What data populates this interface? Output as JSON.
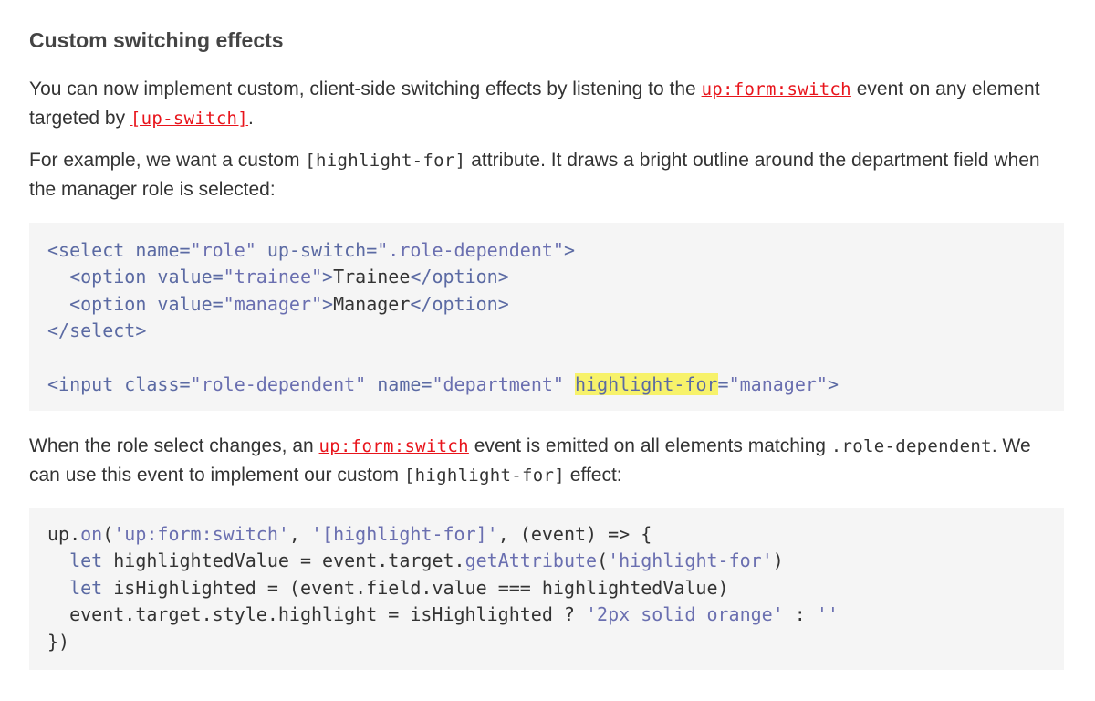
{
  "heading": "Custom switching effects",
  "p1": {
    "t1": "You can now implement custom, client-side switching effects by listening to the ",
    "link1": "up:form:switch",
    "t2": " event on any element targeted by ",
    "link2": "[up-switch]",
    "t3": "."
  },
  "p2": {
    "t1": "For example, we want a custom ",
    "code1": "[highlight-for]",
    "t2": " attribute. It draws a bright outline around the department field when the manager role is selected:"
  },
  "code1": {
    "l1": {
      "a": "<select",
      "b": " name=",
      "c": "\"role\"",
      "d": " up-switch=",
      "e": "\".role-dependent\"",
      "f": ">"
    },
    "l2": {
      "a": "  <option",
      "b": " value=",
      "c": "\"trainee\"",
      "d": ">",
      "e": "Trainee",
      "f": "</option>"
    },
    "l3": {
      "a": "  <option",
      "b": " value=",
      "c": "\"manager\"",
      "d": ">",
      "e": "Manager",
      "f": "</option>"
    },
    "l4": {
      "a": "</select>"
    },
    "l6": {
      "a": "<input",
      "b": " class=",
      "c": "\"role-dependent\"",
      "d": " name=",
      "e": "\"department\"",
      "f": " ",
      "g": "highlight-for",
      "h": "=",
      "i": "\"manager\"",
      "j": ">"
    }
  },
  "p3": {
    "t1": "When the role select changes, an ",
    "link1": "up:form:switch",
    "t2": " event is emitted on all elements matching ",
    "code1": ".role-dependent",
    "t3": ". We can use this event to implement our custom ",
    "code2": "[highlight-for]",
    "t4": " effect:"
  },
  "code2": {
    "l1": {
      "a": "up.",
      "b": "on",
      "c": "(",
      "d": "'up:form:switch'",
      "e": ", ",
      "f": "'[highlight-for]'",
      "g": ", (event) => {"
    },
    "l2": {
      "a": "  ",
      "b": "let",
      "c": " highlightedValue = event.target.",
      "d": "getAttribute",
      "e": "(",
      "f": "'highlight-for'",
      "g": ")"
    },
    "l3": {
      "a": "  ",
      "b": "let",
      "c": " isHighlighted = (event.field.value === highlightedValue)"
    },
    "l4": {
      "a": "  event.target.style.highlight = isHighlighted ? ",
      "b": "'2px solid orange'",
      "c": " : ",
      "d": "''"
    },
    "l5": {
      "a": "})"
    }
  },
  "colors": {
    "link": "#e8141b",
    "code_background": "#f5f5f5",
    "syntax_tag": "#5b6aa3",
    "syntax_string": "#6a6fb0",
    "highlight": "#f7f26a"
  }
}
